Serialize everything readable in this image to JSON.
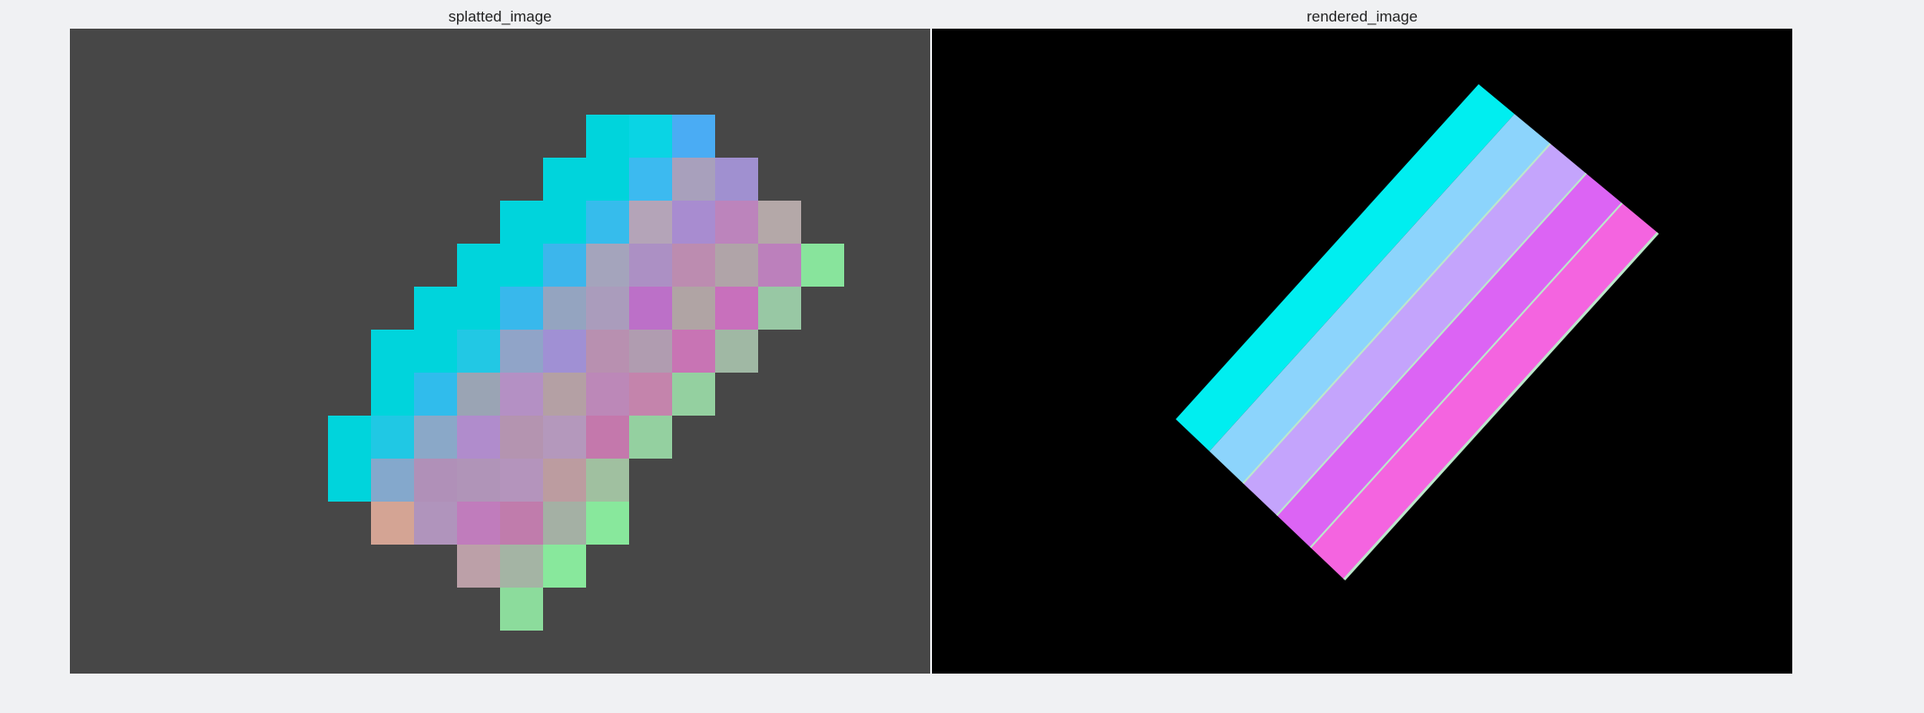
{
  "panels": {
    "left_title": "splatted_image",
    "right_title": "rendered_image"
  },
  "colors": {
    "page_background": "#f0f1f3",
    "splatted_background": "#474747",
    "rendered_background": "#000000"
  },
  "splatted_grid": {
    "cells": [
      [
        0,
        6,
        "#00d4dc"
      ],
      [
        0,
        7,
        "#0ad4e4"
      ],
      [
        0,
        8,
        "#4aacf4"
      ],
      [
        1,
        5,
        "#00d4dc"
      ],
      [
        1,
        6,
        "#00d4dc"
      ],
      [
        1,
        7,
        "#3cbaf0"
      ],
      [
        1,
        8,
        "#a8a0bc"
      ],
      [
        1,
        9,
        "#a090d0"
      ],
      [
        2,
        4,
        "#00d4dc"
      ],
      [
        2,
        5,
        "#00d4dc"
      ],
      [
        2,
        6,
        "#36bcec"
      ],
      [
        2,
        7,
        "#b4a4b8"
      ],
      [
        2,
        8,
        "#a88cd0"
      ],
      [
        2,
        9,
        "#bc84bc"
      ],
      [
        2,
        10,
        "#b4a8a8"
      ],
      [
        3,
        3,
        "#00d4dc"
      ],
      [
        3,
        4,
        "#00d4dc"
      ],
      [
        3,
        5,
        "#3cb6ec"
      ],
      [
        3,
        6,
        "#a4a4bc"
      ],
      [
        3,
        7,
        "#ac90c4"
      ],
      [
        3,
        8,
        "#bc8cb0"
      ],
      [
        3,
        9,
        "#b0a4a8"
      ],
      [
        3,
        10,
        "#bc80bc"
      ],
      [
        3,
        11,
        "#88e49c"
      ],
      [
        4,
        2,
        "#00d4dc"
      ],
      [
        4,
        3,
        "#00d4dc"
      ],
      [
        4,
        4,
        "#38b8ec"
      ],
      [
        4,
        5,
        "#94a4c0"
      ],
      [
        4,
        6,
        "#aa9cbc"
      ],
      [
        4,
        7,
        "#bc70c8"
      ],
      [
        4,
        8,
        "#b0a4a4"
      ],
      [
        4,
        9,
        "#c870bc"
      ],
      [
        4,
        10,
        "#98c8a4"
      ],
      [
        5,
        1,
        "#00d4dc"
      ],
      [
        5,
        2,
        "#00d4dc"
      ],
      [
        5,
        3,
        "#22c8e4"
      ],
      [
        5,
        4,
        "#90a4c8"
      ],
      [
        5,
        5,
        "#a090d4"
      ],
      [
        5,
        6,
        "#b890b0"
      ],
      [
        5,
        7,
        "#b09cb0"
      ],
      [
        5,
        8,
        "#c874b4"
      ],
      [
        5,
        9,
        "#a0b8a4"
      ],
      [
        6,
        1,
        "#00d4dc"
      ],
      [
        6,
        2,
        "#30bcec"
      ],
      [
        6,
        3,
        "#9aa4b4"
      ],
      [
        6,
        4,
        "#b490c4"
      ],
      [
        6,
        5,
        "#b4a0a4"
      ],
      [
        6,
        6,
        "#bc88b8"
      ],
      [
        6,
        7,
        "#c484ac"
      ],
      [
        6,
        8,
        "#94d0a0"
      ],
      [
        7,
        0,
        "#00d4dc"
      ],
      [
        7,
        1,
        "#20c8e4"
      ],
      [
        7,
        2,
        "#8aa8c8"
      ],
      [
        7,
        3,
        "#b08ccc"
      ],
      [
        7,
        4,
        "#b494b0"
      ],
      [
        7,
        5,
        "#b498bc"
      ],
      [
        7,
        6,
        "#c478ac"
      ],
      [
        7,
        7,
        "#94d0a0"
      ],
      [
        8,
        0,
        "#00d4dc"
      ],
      [
        8,
        1,
        "#84a8cc"
      ],
      [
        8,
        2,
        "#b090b8"
      ],
      [
        8,
        3,
        "#b094b8"
      ],
      [
        8,
        4,
        "#b494bc"
      ],
      [
        8,
        5,
        "#bc9ca0"
      ],
      [
        8,
        6,
        "#a0c0a0"
      ],
      [
        9,
        1,
        "#d4a494"
      ],
      [
        9,
        2,
        "#b094bc"
      ],
      [
        9,
        3,
        "#c07cbc"
      ],
      [
        9,
        4,
        "#c07cac"
      ],
      [
        9,
        5,
        "#a4b0a4"
      ],
      [
        9,
        6,
        "#88e89c"
      ],
      [
        10,
        3,
        "#bca0a8"
      ],
      [
        10,
        4,
        "#a4b4a4"
      ],
      [
        10,
        5,
        "#88e89c"
      ],
      [
        11,
        4,
        "#8cdc9c"
      ]
    ]
  },
  "rendered_stripes": [
    {
      "color": "#00eef0"
    },
    {
      "color": "#8cd4fc"
    },
    {
      "color": "#c4a4fc"
    },
    {
      "color": "#dc64f4"
    },
    {
      "color": "#f464e0"
    }
  ],
  "rendered_edge_color": "#bce8cc"
}
